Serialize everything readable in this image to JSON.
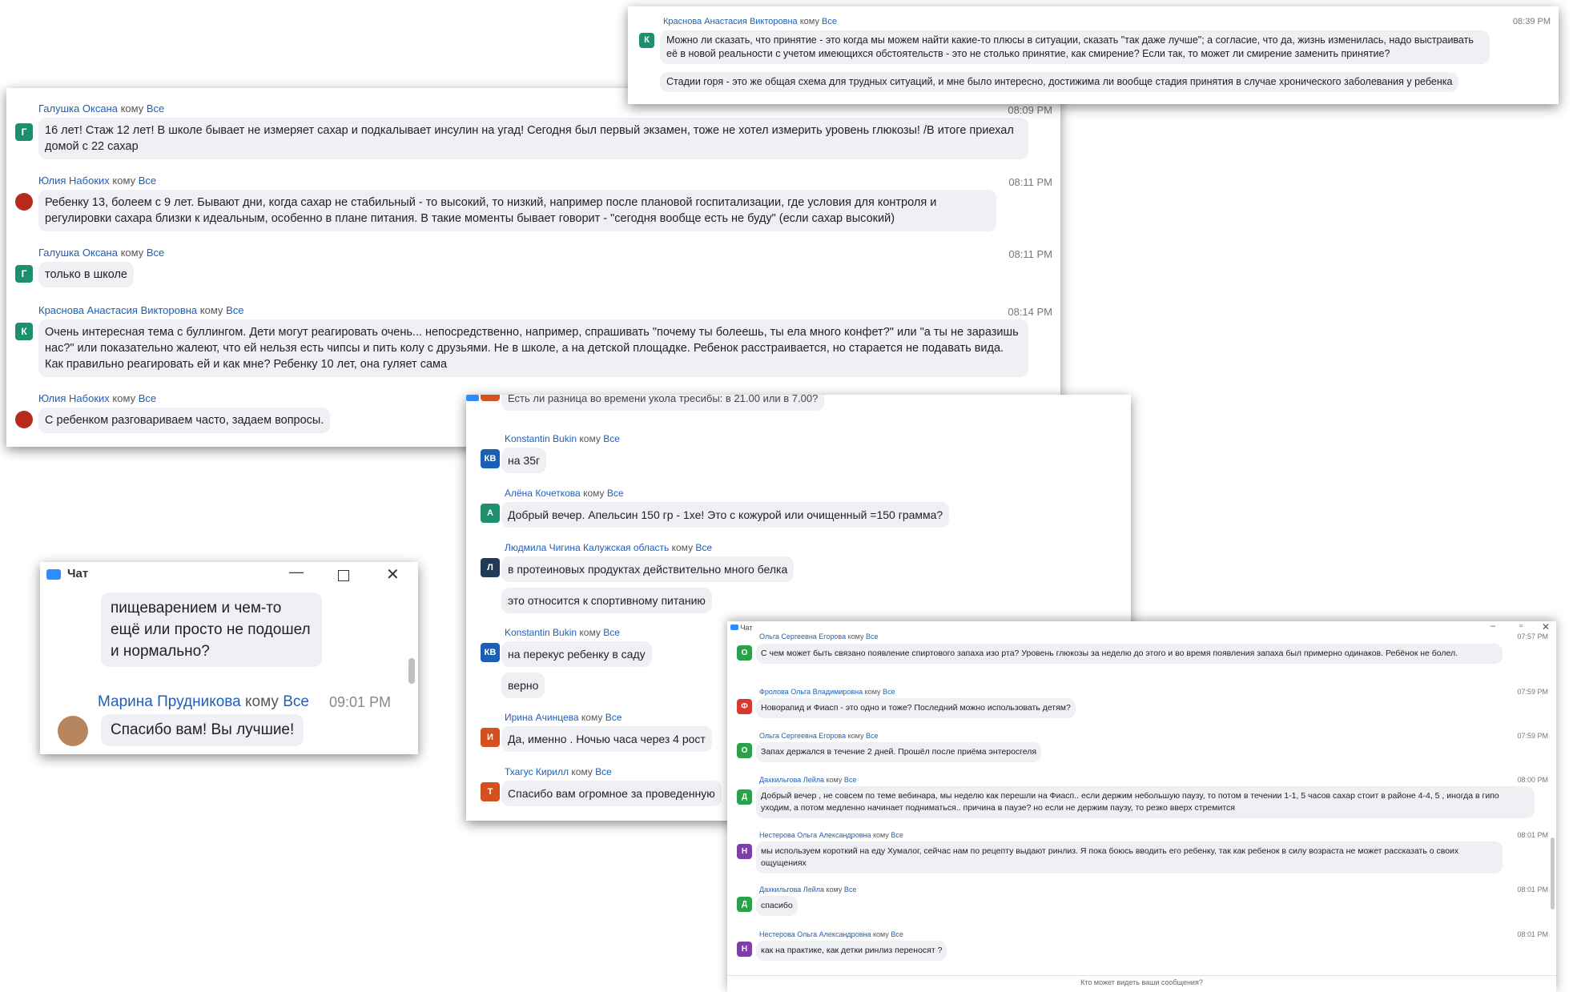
{
  "recipient_word": "кому",
  "recipient_all": "Все",
  "chat_title": "Чат",
  "panel_a": {
    "messages": [
      {
        "sender": "Галушка Оксана",
        "avatar": "Г",
        "avatar_color": "#1d8f6e",
        "time": "08:09 PM",
        "texts": [
          "16 лет! Стаж  12 лет! В школе бывает не измеряет сахар и подкалывает инсулин на угад! Сегодня был первый экзамен, тоже не хотел измерить уровень глюкозы! /В итоге приехал домой с 22 сахар"
        ]
      },
      {
        "sender": "Юлия Набоких",
        "avatar": "",
        "avatar_color": "#b52a1e",
        "time": "08:11 PM",
        "texts": [
          "Ребенку 13, болеем с 9 лет. Бывают дни, когда сахар не стабильный - то высокий, то низкий, например после плановой госпитализации, где условия для контроля и регулировки сахара близки к идеальным, особенно в плане питания. В такие моменты бывает говорит - \"сегодня вообще есть не буду\" (если сахар высокий)"
        ]
      },
      {
        "sender": "Галушка Оксана",
        "avatar": "Г",
        "avatar_color": "#1d8f6e",
        "time": "08:11 PM",
        "texts": [
          "только в школе"
        ]
      },
      {
        "sender": "Краснова Анастасия Викторовна",
        "avatar": "К",
        "avatar_color": "#1d8f6e",
        "time": "08:14 PM",
        "texts": [
          "Очень интересная тема с буллингом. Дети могут реагировать очень... непосредственно, например, спрашивать \"почему ты болеешь, ты ела много конфет?\" или \"а ты не заразишь нас?\" или показательно жалеют, что ей нельзя есть чипсы и пить колу с друзьями. Не в школе, а на детской площадке. Ребенок расстраивается, но старается не подавать вида. Как правильно реагировать ей и как мне? Ребенку 10 лет, она гуляет сама"
        ]
      },
      {
        "sender": "Юлия Набоких",
        "avatar": "",
        "avatar_color": "#b52a1e",
        "time": "",
        "texts": [
          "С ребенком разговариваем часто, задаем вопросы."
        ]
      }
    ]
  },
  "panel_b": {
    "messages": [
      {
        "sender": "Краснова Анастасия Викторовна",
        "avatar": "К",
        "avatar_color": "#1d8f6e",
        "time": "08:39 PM",
        "texts": [
          "Можно ли сказать, что принятие - это когда мы можем найти какие-то плюсы в ситуации, сказать \"так даже лучше\"; а согласие, что да, жизнь изменилась, надо выстраивать её в новой реальности с учетом имеющихся обстоятельств - это не столько принятие, как смирение? Если так, то может ли смирение заменить принятие?",
          "Стадии горя - это же общая схема для трудных ситуаций, и мне было интересно, достижима ли вообще стадия принятия в случае хронического заболевания у ребенка"
        ]
      }
    ]
  },
  "panel_c": {
    "partial_top": "Есть ли разница во времени укола тресибы: в 21.00 или в 7.00?",
    "messages": [
      {
        "sender": "Konstantin Bukin",
        "avatar": "КВ",
        "avatar_color": "#1a5fb4",
        "texts": [
          "на 35г"
        ]
      },
      {
        "sender": "Алёна Кочеткова",
        "avatar": "А",
        "avatar_color": "#1d8f6e",
        "texts": [
          "Добрый вечер. Апельсин 150 гр - 1хе! Это с кожурой или очищенный =150 грамма?"
        ]
      },
      {
        "sender": "Людмила Чигина Калужская область",
        "avatar": "Л",
        "avatar_color": "#1f3b57",
        "texts": [
          "в протеиновых продуктах действительно много белка",
          "это относится к спортивному питанию"
        ]
      },
      {
        "sender": "Konstantin Bukin",
        "avatar": "КВ",
        "avatar_color": "#1a5fb4",
        "texts": [
          "на перекус ребенку в саду",
          "верно"
        ]
      },
      {
        "sender": "Ирина Ачинцева",
        "avatar": "И",
        "avatar_color": "#d4501e",
        "texts": [
          "Да, именно . Ночью часа через 4 рост"
        ]
      },
      {
        "sender": "Тхагус Кирилл",
        "avatar": "Т",
        "avatar_color": "#d4501e",
        "texts": [
          "Спасибо вам огромное за проведенную"
        ]
      }
    ]
  },
  "panel_d": {
    "footer": "Кто может видеть ваши сообщения?",
    "messages": [
      {
        "sender": "Ольга Сергеевна Егорова",
        "avatar": "О",
        "avatar_color": "#2aa14a",
        "time": "07:57 PM",
        "texts": [
          "С чем может быть связано появление спиртового запаха изо рта? Уровень глюкозы за неделю до этого и во время появления запаха был примерно одинаков. Ребёнок не болел."
        ]
      },
      {
        "sender": "Фролова Ольга Владимировна",
        "avatar": "Ф",
        "avatar_color": "#d63a2e",
        "time": "07:59 PM",
        "texts": [
          "Новорапид и Фиасп - это одно и тоже? Последний можно использовать детям?"
        ]
      },
      {
        "sender": "Ольга Сергеевна Егорова",
        "avatar": "О",
        "avatar_color": "#2aa14a",
        "time": "07:59 PM",
        "texts": [
          "Запах держался в течение 2 дней. Прошёл после приёма энтеросгеля"
        ]
      },
      {
        "sender": "Дахкильгова Лейла",
        "avatar": "Д",
        "avatar_color": "#2aa14a",
        "time": "08:00 PM",
        "texts": [
          "Добрый вечер , не совсем по теме вебинара, мы неделю как перешли на Фиасп.. если держим небольшую паузу, то потом в течении 1-1, 5 часов сахар стоит в районе 4-4, 5 , иногда в гипо уходим, а потом медленно начинает подниматься.. причина в паузе?  но если не держим паузу, то резко вверх стремится"
        ]
      },
      {
        "sender": "Нестерова Ольга Александровна",
        "avatar": "Н",
        "avatar_color": "#7e3fa8",
        "time": "08:01 PM",
        "texts": [
          "мы используем короткий на еду Хумалог, сейчас нам по рецепту выдают ринлиз. Я пока боюсь вводить его ребенку, так как ребенок в силу возраста не может рассказать о своих ощущениях"
        ]
      },
      {
        "sender": "Дахкильгова Лейла",
        "avatar": "Д",
        "avatar_color": "#2aa14a",
        "time": "08:01 PM",
        "texts": [
          "спасибо"
        ]
      },
      {
        "sender": "Нестерова Ольга Александровна",
        "avatar": "Н",
        "avatar_color": "#7e3fa8",
        "time": "08:01 PM",
        "texts": [
          "как на практике, как детки ринлиз переносят ?"
        ]
      }
    ]
  },
  "panel_e": {
    "partial_text": "пищеварением и чем-то ещё или просто не подошел и нормально?",
    "sender": "Марина Прудникова",
    "time": "09:01 PM",
    "text": "Спасибо вам! Вы лучшие!"
  }
}
